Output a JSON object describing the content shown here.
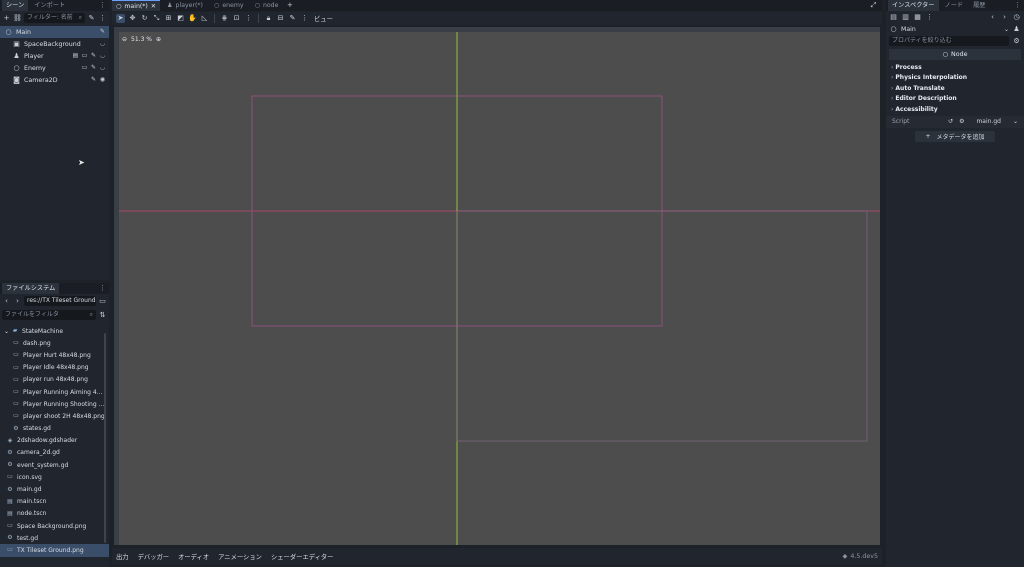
{
  "scene_dock": {
    "tabs": [
      "シーン",
      "インポート"
    ],
    "filter_placeholder": "フィルター: 名前",
    "nodes": [
      {
        "name": "Main",
        "icon": "node-circle-icon",
        "selected": true
      },
      {
        "name": "SpaceBackground",
        "icon": "sprite-icon"
      },
      {
        "name": "Player",
        "icon": "character-icon"
      },
      {
        "name": "Enemy",
        "icon": "node-circle-icon"
      },
      {
        "name": "Camera2D",
        "icon": "camera-icon"
      }
    ]
  },
  "filesystem": {
    "tab": "ファイルシステム",
    "path": "res://TX Tileset Ground.pn",
    "filter_placeholder": "ファイルをフィルタ",
    "items": [
      {
        "name": "StateMachine",
        "icon": "folder-icon"
      },
      {
        "name": "dash.png",
        "icon": "image-icon"
      },
      {
        "name": "Player Hurt 48x48.png",
        "icon": "image-icon"
      },
      {
        "name": "Player Idle 48x48.png",
        "icon": "image-icon"
      },
      {
        "name": "player run 48x48.png",
        "icon": "image-icon"
      },
      {
        "name": "Player Running Aiming 4...",
        "icon": "image-icon"
      },
      {
        "name": "Player Running Shooting ...",
        "icon": "image-icon"
      },
      {
        "name": "player shoot 2H 48x48.png",
        "icon": "image-icon"
      },
      {
        "name": "states.gd",
        "icon": "gear-icon"
      },
      {
        "name": "2dshadow.gdshader",
        "icon": "shader-icon"
      },
      {
        "name": "camera_2d.gd",
        "icon": "gear-icon"
      },
      {
        "name": "event_system.gd",
        "icon": "gear-icon"
      },
      {
        "name": "icon.svg",
        "icon": "image-icon"
      },
      {
        "name": "main.gd",
        "icon": "gear-icon"
      },
      {
        "name": "main.tscn",
        "icon": "scene-icon"
      },
      {
        "name": "node.tscn",
        "icon": "scene-icon"
      },
      {
        "name": "Space Background.png",
        "icon": "image-icon"
      },
      {
        "name": "test.gd",
        "icon": "gear-icon"
      },
      {
        "name": "TX Tileset Ground.png",
        "icon": "image-icon",
        "selected": true
      }
    ]
  },
  "scene_tabs": [
    {
      "label": "main(*)",
      "active": true
    },
    {
      "label": "player(*)"
    },
    {
      "label": "enemy"
    },
    {
      "label": "node"
    }
  ],
  "viewport": {
    "zoom": "51.3 %",
    "view_menu": "ビュー"
  },
  "bottom_panel": {
    "tabs": [
      "出力",
      "デバッガー",
      "オーディオ",
      "アニメーション",
      "シェーダーエディター"
    ],
    "version": "4.5.dev5"
  },
  "inspector": {
    "tabs": [
      "インスペクター",
      "ノード",
      "履歴"
    ],
    "object": "Main",
    "filter_placeholder": "プロパティを絞り込む",
    "class_name": "Node",
    "sections": [
      "Process",
      "Physics Interpolation",
      "Auto Translate",
      "Editor Description",
      "Accessibility"
    ],
    "script_label": "Script",
    "script_value": "main.gd",
    "add_metadata": "メタデータを追加"
  },
  "colors": {
    "accent": "#6b9eff",
    "selection": "#3a4d69",
    "viewport_bg": "#4d4d4d",
    "axis_y": "#8fbf3f",
    "axis_x": "#a8456a"
  }
}
